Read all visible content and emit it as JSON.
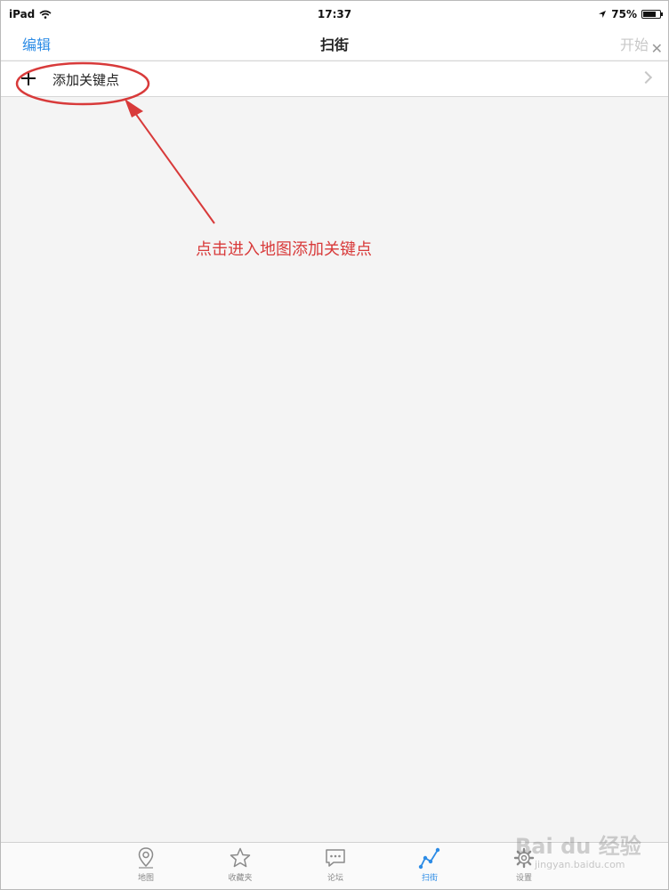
{
  "status_bar": {
    "device": "iPad",
    "time": "17:37",
    "battery_percent_text": "75%",
    "battery_level": 0.75
  },
  "nav_bar": {
    "left_button": "编辑",
    "title": "扫街",
    "right_button": "开始"
  },
  "list": {
    "items": [
      {
        "label": "添加关键点",
        "icon": "plus-icon"
      }
    ]
  },
  "annotation": {
    "text": "点击进入地图添加关键点",
    "color": "#d83a3a"
  },
  "tab_bar": {
    "tabs": [
      {
        "label": "地图",
        "icon": "map-pin-icon",
        "active": false
      },
      {
        "label": "收藏夹",
        "icon": "star-icon",
        "active": false
      },
      {
        "label": "论坛",
        "icon": "chat-icon",
        "active": false
      },
      {
        "label": "扫街",
        "icon": "route-icon",
        "active": true
      },
      {
        "label": "设置",
        "icon": "gear-icon",
        "active": false
      }
    ]
  },
  "watermark": {
    "text": "Bai du 经验",
    "url": "jingyan.baidu.com"
  },
  "colors": {
    "accent": "#2d8ce6",
    "disabled": "#c8c8c8",
    "background": "#f4f4f4"
  }
}
